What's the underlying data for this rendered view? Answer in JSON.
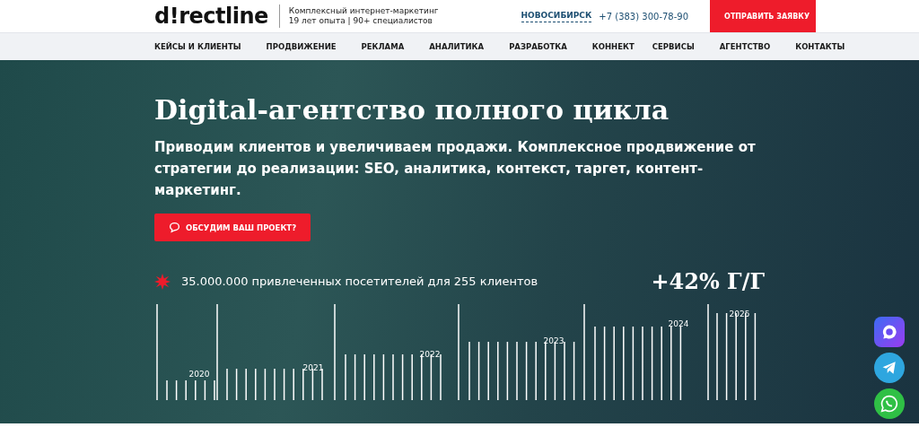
{
  "header": {
    "logo": "d!rectline",
    "tagline": [
      "Комплексный интернет-маркетинг",
      "19 лет опыта | 90+ специалистов"
    ],
    "city": "НОВОСИБИРСК",
    "phone": "+7 (383) 300-78-90",
    "cta": "ОТПРАВИТЬ ЗАЯВКУ"
  },
  "nav": [
    "КЕЙСЫ И КЛИЕНТЫ",
    "ПРОДВИЖЕНИЕ",
    "РЕКЛАМА",
    "АНАЛИТИКА",
    "РАЗРАБОТКА",
    "КОННЕКТ",
    "СЕРВИСЫ",
    "АГЕНТСТВО",
    "КОНТАКТЫ"
  ],
  "hero": {
    "title": "Digital-агентство полного цикла",
    "subtitle": "Приводим клиентов и увеличиваем продажи. Комплексное продвижение от стратегии до реализации: SEO, аналитика, контекст, таргет, контент-маркетинг.",
    "button": "ОБСУДИМ ВАШ ПРОЕКТ?",
    "stat": "35.000.000 привлеченных посетителей для 255 клиентов",
    "growth": "+42% Г/Г",
    "years": [
      "2020",
      "2021",
      "2022",
      "2023",
      "2024",
      "2025"
    ]
  }
}
